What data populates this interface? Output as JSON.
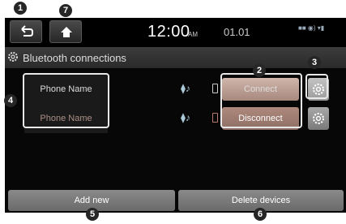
{
  "topbar": {
    "time": "12:00",
    "ampm": "AM",
    "date": "01.01",
    "status_text": "■■ ◉) ▾▮"
  },
  "title": "Bluetooth connections",
  "devices": [
    {
      "name": "Phone Name",
      "action": "Connect"
    },
    {
      "name": "Phone Name",
      "action": "Disconnect"
    }
  ],
  "bottom": {
    "add_label": "Add new",
    "delete_label": "Delete devices"
  },
  "icons": {
    "back": "back-icon",
    "home": "home-icon",
    "settings": "settings-gear-icon",
    "music": "music-note-icon",
    "phone": "phone-icon"
  },
  "markers": [
    "1",
    "2",
    "3",
    "4",
    "5",
    "6",
    "7"
  ],
  "colors": {
    "screen_bg": "#070707",
    "button_brown": "#a7887d",
    "marker_bg": "#262626"
  }
}
